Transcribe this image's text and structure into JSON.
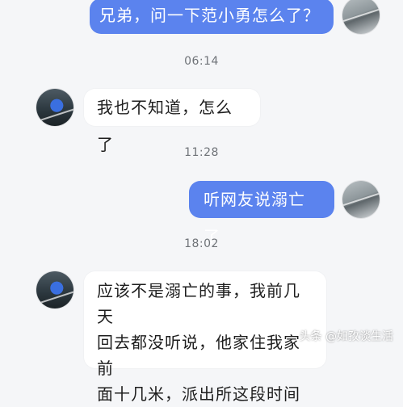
{
  "messages": [
    {
      "type": "sent",
      "text": "兄弟，问一下范小勇怎么了？"
    },
    {
      "type": "time",
      "text": "06:14"
    },
    {
      "type": "received",
      "text": "我也不知道，怎么了"
    },
    {
      "type": "time",
      "text": "11:28"
    },
    {
      "type": "sent",
      "text": "听网友说溺亡了"
    },
    {
      "type": "time",
      "text": "18:02"
    },
    {
      "type": "received",
      "lines": [
        "应该不是溺亡的事，我前几天",
        "回去都没听说，他家住我家前",
        "面十几米，派出所这段时间"
      ]
    }
  ],
  "watermark": "头条 @如孜谈生活",
  "colors": {
    "sent_bubble": "#5b83ee",
    "received_bubble": "#ffffff",
    "background": "#f5f6f8"
  }
}
